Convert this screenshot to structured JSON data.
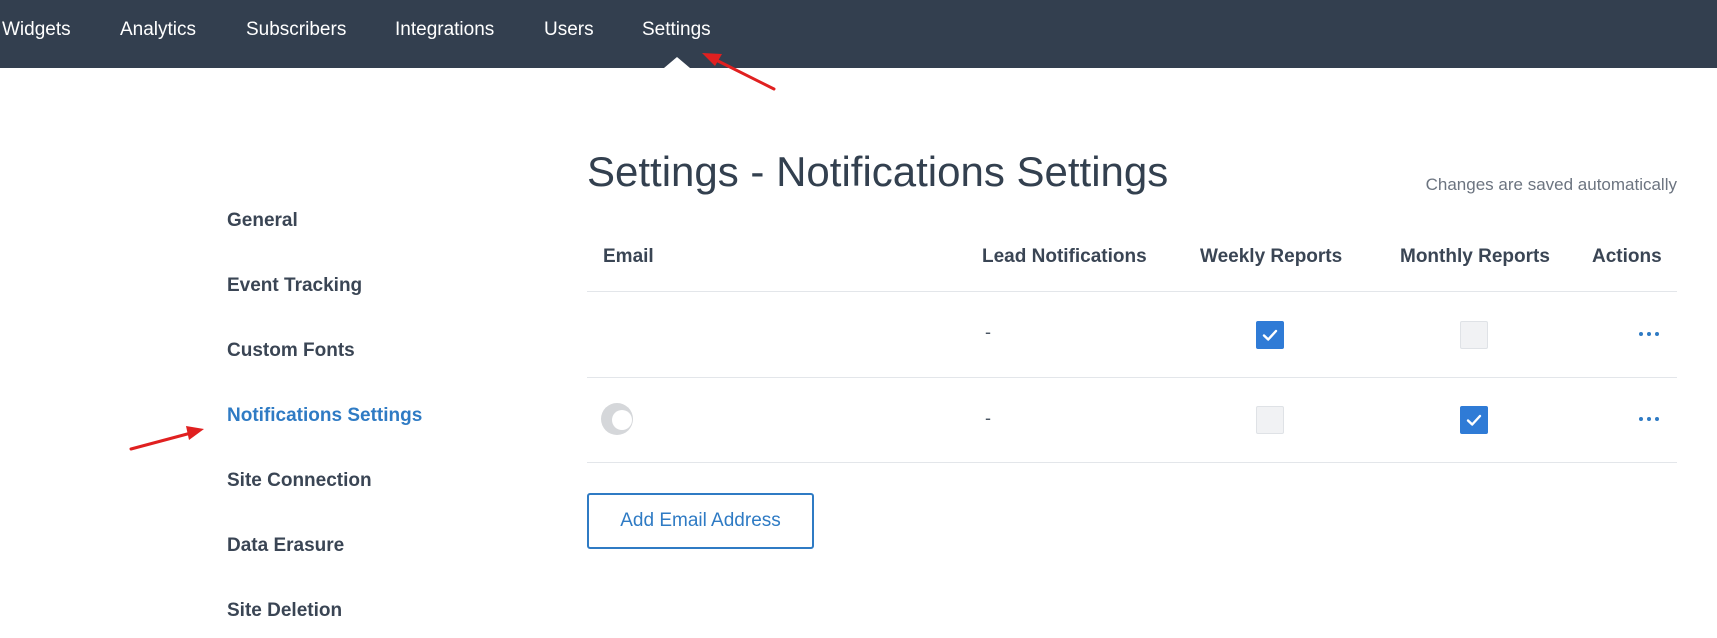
{
  "topnav": {
    "items": [
      {
        "label": "Widgets"
      },
      {
        "label": "Analytics"
      },
      {
        "label": "Subscribers"
      },
      {
        "label": "Integrations"
      },
      {
        "label": "Users"
      },
      {
        "label": "Settings"
      }
    ],
    "active": "Settings"
  },
  "sidebar": {
    "items": [
      {
        "label": "General"
      },
      {
        "label": "Event Tracking"
      },
      {
        "label": "Custom Fonts"
      },
      {
        "label": "Notifications Settings"
      },
      {
        "label": "Site Connection"
      },
      {
        "label": "Data Erasure"
      },
      {
        "label": "Site Deletion"
      }
    ],
    "active": "Notifications Settings"
  },
  "header": {
    "title": "Settings - Notifications Settings",
    "save_note": "Changes are saved automatically"
  },
  "table": {
    "columns": [
      "Email",
      "Lead Notifications",
      "Weekly Reports",
      "Monthly Reports",
      "Actions"
    ],
    "rows": [
      {
        "email": "",
        "has_avatar": false,
        "lead": "-",
        "weekly": true,
        "monthly": false
      },
      {
        "email": "",
        "has_avatar": true,
        "lead": "-",
        "weekly": false,
        "monthly": true
      }
    ]
  },
  "add_button_label": "Add Email Address",
  "colors": {
    "nav_bg": "#333f4f",
    "accent": "#2f7bc4",
    "checkbox_on": "#2f7bd6",
    "annotation_arrow": "#e02020"
  }
}
